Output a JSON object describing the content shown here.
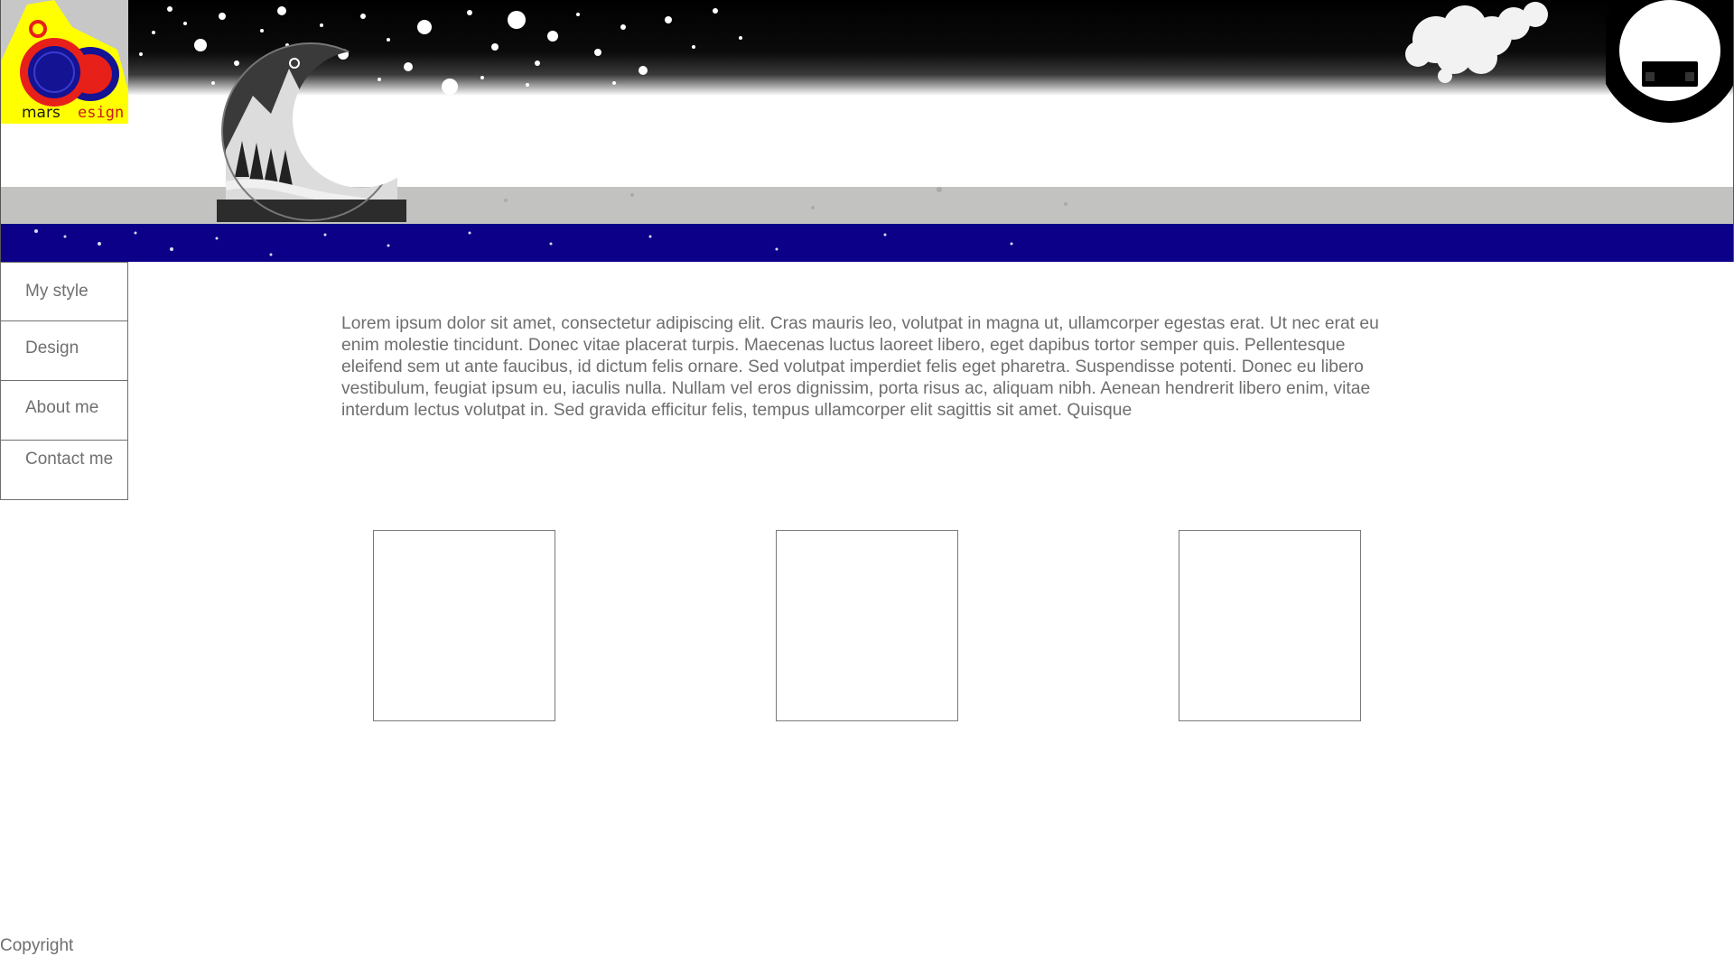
{
  "logo": {
    "text_left": "mars",
    "text_right": "esign"
  },
  "nav": {
    "items": [
      {
        "label": "My style"
      },
      {
        "label": "Design"
      },
      {
        "label": "About me"
      },
      {
        "label": "Contact me"
      }
    ]
  },
  "main": {
    "body_text": "Lorem ipsum dolor sit amet, consectetur adipiscing elit. Cras mauris leo, volutpat in magna ut, ullamcorper egestas erat. Ut nec erat eu enim molestie tincidunt. Donec vitae placerat turpis. Maecenas luctus laoreet libero, eget dapibus tortor semper quis. Pellentesque eleifend sem ut ante faucibus, id dictum felis ornare. Sed volutpat imperdiet felis eget pharetra. Suspendisse potenti. Donec eu libero vestibulum, feugiat ipsum eu, iaculis nulla. Nullam vel eros dignissim, porta risus ac, aliquam nibh. Aenean hendrerit libero enim, vitae interdum lectus volutpat in. Sed gravida efficitur felis, tempus ullamcorper elit sagittis sit amet. Quisque"
  },
  "footer": {
    "copyright": "Copyright"
  },
  "colors": {
    "header_black": "#000000",
    "header_gray": "#c2c2c0",
    "header_blue": "#0c0088",
    "logo_yellow": "#ffff00",
    "logo_red": "#e8201a",
    "logo_navy": "#131393",
    "text": "#6e6e6e"
  },
  "icons": [
    "brand-logo",
    "moon-landscape-emblem",
    "smiley-face-icon",
    "star-splatter-texture",
    "white-tree-silhouette"
  ]
}
